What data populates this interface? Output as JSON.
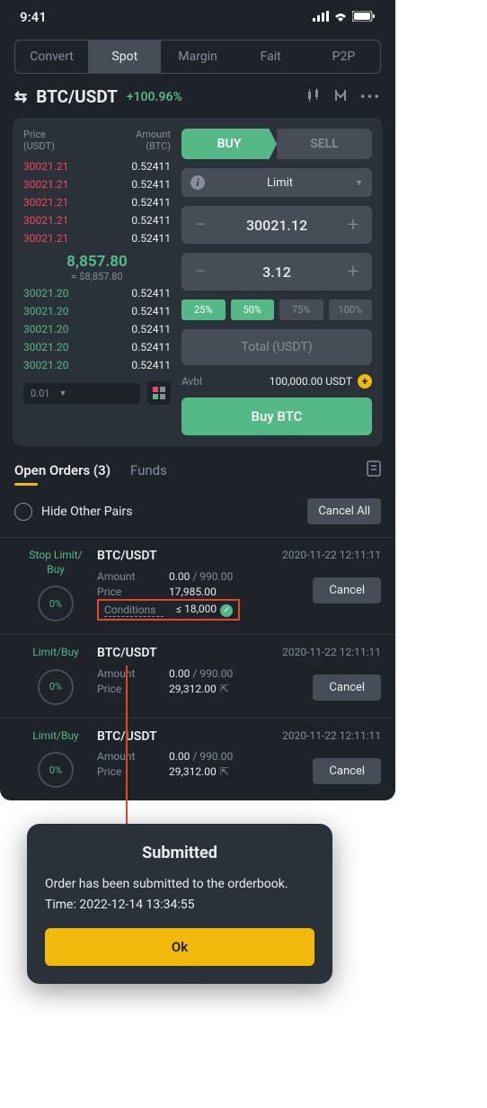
{
  "status": {
    "time": "9:41"
  },
  "tabs": [
    "Convert",
    "Spot",
    "Margin",
    "Fait",
    "P2P"
  ],
  "pair": {
    "symbol": "BTC/USDT",
    "change": "+100.96%"
  },
  "ob": {
    "price_h": "Price\n(USDT)",
    "amount_h": "Amount\n(BTC)",
    "asks": [
      {
        "p": "30021.21",
        "a": "0.52411"
      },
      {
        "p": "30021.21",
        "a": "0.52411"
      },
      {
        "p": "30021.21",
        "a": "0.52411"
      },
      {
        "p": "30021.21",
        "a": "0.52411"
      },
      {
        "p": "30021.21",
        "a": "0.52411"
      }
    ],
    "mid": "8,857.80",
    "mid_fiat": "≈ $8,857.80",
    "bids": [
      {
        "p": "30021.20",
        "a": "0.52411"
      },
      {
        "p": "30021.20",
        "a": "0.52411"
      },
      {
        "p": "30021.20",
        "a": "0.52411"
      },
      {
        "p": "30021.20",
        "a": "0.52411"
      },
      {
        "p": "30021.20",
        "a": "0.52411"
      }
    ],
    "precision": "0.01"
  },
  "form": {
    "buy": "BUY",
    "sell": "SELL",
    "order_type": "Limit",
    "price": "30021.12",
    "amount": "3.12",
    "qp": [
      "25%",
      "50%",
      "75%",
      "100%"
    ],
    "total_ph": "Total (USDT)",
    "avbl_l": "Avbl",
    "avbl_v": "100,000.00 USDT",
    "buy_btn": "Buy BTC"
  },
  "orders": {
    "tab_open": "Open Orders (3)",
    "tab_funds": "Funds",
    "hide": "Hide Other Pairs",
    "cancel_all": "Cancel All",
    "list": [
      {
        "type": "Stop Limit/\nBuy",
        "pair": "BTC/USDT",
        "stamp": "2020-11-22  12:11:11",
        "amount_l": "Amount",
        "amount_v": "0.00",
        "amount_t": " / 990.00",
        "price_l": "Price",
        "price_v": "17,985.00",
        "cond_l": "Conditions",
        "cond_v": "≤ 18,000",
        "cancel": "Cancel",
        "pct": "0%"
      },
      {
        "type": "Limit/Buy",
        "pair": "BTC/USDT",
        "stamp": "2020-11-22  12:11:11",
        "amount_l": "Amount",
        "amount_v": "0.00",
        "amount_t": " / 990.00",
        "price_l": "Price",
        "price_v": "29,312.00",
        "cancel": "Cancel",
        "pct": "0%",
        "share": true
      },
      {
        "type": "Limit/Buy",
        "pair": "BTC/USDT",
        "stamp": "2020-11-22  12:11:11",
        "amount_l": "Amount",
        "amount_v": "0.00",
        "amount_t": " / 990.00",
        "price_l": "Price",
        "price_v": "29,312.00",
        "cancel": "Cancel",
        "pct": "0%",
        "share": true
      }
    ]
  },
  "toast": {
    "title": "Submitted",
    "msg": "Order has been submitted to the orderbook.",
    "time_l": "Time: ",
    "time_v": "2022-12-14 13:34:55",
    "ok": "Ok"
  }
}
